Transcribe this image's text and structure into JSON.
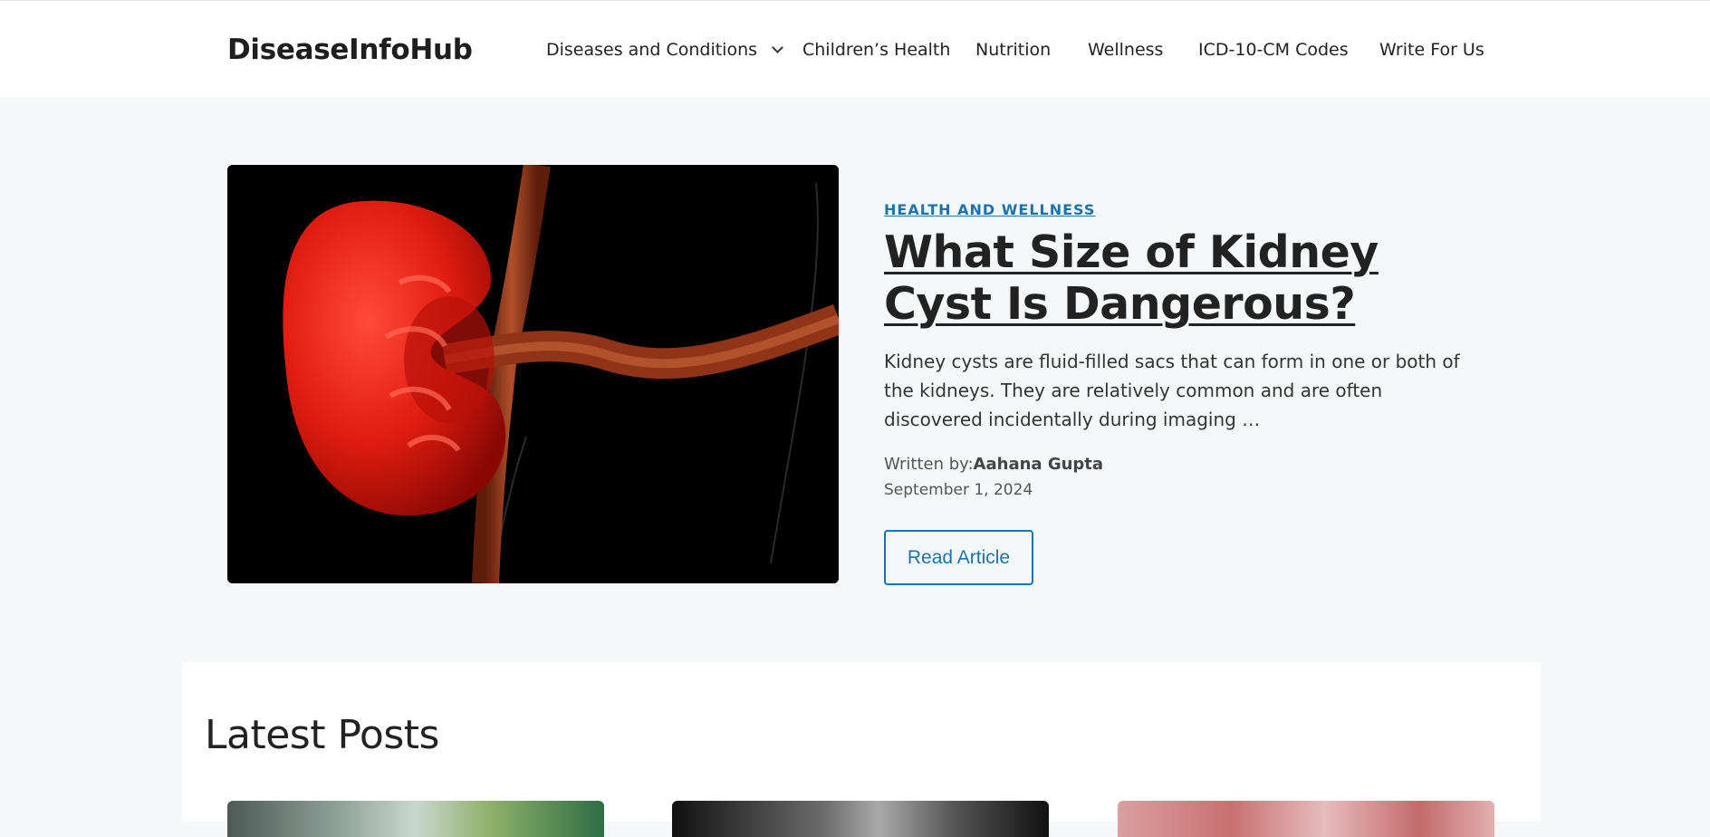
{
  "header": {
    "logo": "DiseaseInfoHub",
    "nav": [
      {
        "label": "Diseases and Conditions",
        "has_dropdown": true
      },
      {
        "label": "Children’s Health"
      },
      {
        "label": "Nutrition"
      },
      {
        "label": "Wellness"
      },
      {
        "label": "ICD-10-CM Codes"
      },
      {
        "label": "Write For Us"
      }
    ]
  },
  "hero": {
    "category": "HEALTH AND WELLNESS",
    "title": "What Size of Kidney Cyst Is Dangerous?",
    "excerpt": "Kidney cysts are fluid-filled sacs that can form in one or both of the kidneys. They are relatively common and are often discovered incidentally during imaging …",
    "byline_prefix": "Written by:",
    "author": "Aahana Gupta",
    "date": "September 1, 2024",
    "button": "Read Article",
    "image_icon": "kidney-illustration"
  },
  "latest": {
    "heading": "Latest Posts"
  },
  "colors": {
    "accent": "#1e73a8",
    "background": "#f5f7f8"
  }
}
